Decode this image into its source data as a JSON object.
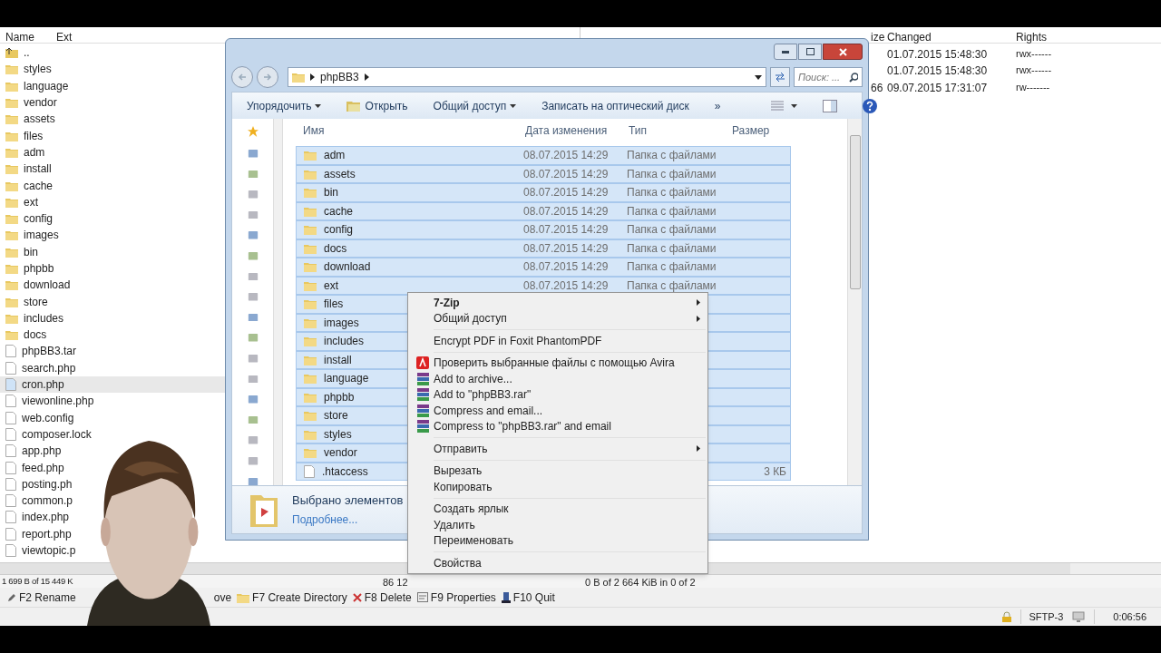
{
  "file_manager": {
    "left_columns": [
      "Name",
      "Ext"
    ],
    "right_columns": [
      "ize",
      "Changed",
      "Rights"
    ],
    "left_rows": [
      {
        "name": "..",
        "kind": "parent",
        "selected": false
      },
      {
        "name": "styles",
        "kind": "folder",
        "selected": false
      },
      {
        "name": "language",
        "kind": "folder",
        "selected": false
      },
      {
        "name": "vendor",
        "kind": "folder",
        "selected": false
      },
      {
        "name": "assets",
        "kind": "folder",
        "selected": false
      },
      {
        "name": "files",
        "kind": "folder",
        "selected": false
      },
      {
        "name": "adm",
        "kind": "folder",
        "selected": false
      },
      {
        "name": "install",
        "kind": "folder",
        "selected": false
      },
      {
        "name": "cache",
        "kind": "folder",
        "selected": false
      },
      {
        "name": "ext",
        "kind": "folder",
        "selected": false
      },
      {
        "name": "config",
        "kind": "folder",
        "selected": false
      },
      {
        "name": "images",
        "kind": "folder",
        "selected": false
      },
      {
        "name": "bin",
        "kind": "folder",
        "selected": false
      },
      {
        "name": "phpbb",
        "kind": "folder",
        "selected": false
      },
      {
        "name": "download",
        "kind": "folder",
        "selected": false
      },
      {
        "name": "store",
        "kind": "folder",
        "selected": false
      },
      {
        "name": "includes",
        "kind": "folder",
        "selected": false
      },
      {
        "name": "docs",
        "kind": "folder",
        "selected": false
      },
      {
        "name": "phpBB3.tar",
        "kind": "file",
        "selected": false
      },
      {
        "name": "search.php",
        "kind": "file",
        "selected": false
      },
      {
        "name": "cron.php",
        "kind": "file",
        "selected": true
      },
      {
        "name": "viewonline.php",
        "kind": "file",
        "selected": false
      },
      {
        "name": "web.config",
        "kind": "file",
        "selected": false
      },
      {
        "name": "composer.lock",
        "kind": "file",
        "selected": false
      },
      {
        "name": "app.php",
        "kind": "file",
        "selected": false
      },
      {
        "name": "feed.php",
        "kind": "file",
        "selected": false
      },
      {
        "name": "posting.ph",
        "kind": "file",
        "selected": false
      },
      {
        "name": "common.p",
        "kind": "file",
        "selected": false
      },
      {
        "name": "index.php",
        "kind": "file",
        "selected": false
      },
      {
        "name": "report.php",
        "kind": "file",
        "selected": false
      },
      {
        "name": "viewtopic.p",
        "kind": "file",
        "selected": false
      }
    ],
    "right_rows": [
      {
        "size": "",
        "changed": "01.07.2015 15:48:30",
        "rights": "rwx------"
      },
      {
        "size": "",
        "changed": "01.07.2015 15:48:30",
        "rights": "rwx------"
      },
      {
        "size": "66",
        "changed": "09.07.2015 17:31:07",
        "rights": "rw-------"
      }
    ],
    "left_status": "1 699 B of 15 449 K",
    "middle_status": "86 12",
    "right_status": "0 B of 2 664 KiB in 0 of 2",
    "function_keys": [
      {
        "label": "F2 Rename",
        "kind": "pencil"
      },
      {
        "label": "ove",
        "kind": "none"
      },
      {
        "label": "F7 Create Directory",
        "kind": "folder"
      },
      {
        "label": "F8 Delete",
        "kind": "cross"
      },
      {
        "label": "F9 Properties",
        "kind": "props"
      },
      {
        "label": "F10 Quit",
        "kind": "quit"
      }
    ],
    "protocol": "SFTP-3",
    "elapsed": "0:06:56"
  },
  "explorer": {
    "path": "phpBB3",
    "search_placeholder": "Поиск: ...",
    "toolbar": [
      {
        "label": "Упорядочить",
        "kind": "dropdown"
      },
      {
        "label": "Открыть",
        "kind": "open"
      },
      {
        "label": "Общий доступ",
        "kind": "dropdown"
      },
      {
        "label": "Записать на оптический диск",
        "kind": "plain"
      },
      {
        "label": "»",
        "kind": "plain"
      }
    ],
    "columns": [
      "Имя",
      "Дата изменения",
      "Тип",
      "Размер"
    ],
    "rows": [
      {
        "name": "adm",
        "kind": "folder",
        "date": "08.07.2015 14:29",
        "type": "Папка с файлами",
        "size": "",
        "selected": true
      },
      {
        "name": "assets",
        "kind": "folder",
        "date": "08.07.2015 14:29",
        "type": "Папка с файлами",
        "size": "",
        "selected": true
      },
      {
        "name": "bin",
        "kind": "folder",
        "date": "08.07.2015 14:29",
        "type": "Папка с файлами",
        "size": "",
        "selected": true
      },
      {
        "name": "cache",
        "kind": "folder",
        "date": "08.07.2015 14:29",
        "type": "Папка с файлами",
        "size": "",
        "selected": true
      },
      {
        "name": "config",
        "kind": "folder",
        "date": "08.07.2015 14:29",
        "type": "Папка с файлами",
        "size": "",
        "selected": true
      },
      {
        "name": "docs",
        "kind": "folder",
        "date": "08.07.2015 14:29",
        "type": "Папка с файлами",
        "size": "",
        "selected": true
      },
      {
        "name": "download",
        "kind": "folder",
        "date": "08.07.2015 14:29",
        "type": "Папка с файлами",
        "size": "",
        "selected": true
      },
      {
        "name": "ext",
        "kind": "folder",
        "date": "08.07.2015 14:29",
        "type": "Папка с файлами",
        "size": "",
        "selected": true
      },
      {
        "name": "files",
        "kind": "folder",
        "date": "",
        "type": "",
        "size": "",
        "selected": true
      },
      {
        "name": "images",
        "kind": "folder",
        "date": "",
        "type": "",
        "size": "",
        "selected": true
      },
      {
        "name": "includes",
        "kind": "folder",
        "date": "",
        "type": "",
        "size": "",
        "selected": true
      },
      {
        "name": "install",
        "kind": "folder",
        "date": "",
        "type": "",
        "size": "",
        "selected": true
      },
      {
        "name": "language",
        "kind": "folder",
        "date": "",
        "type": "",
        "size": "",
        "selected": true
      },
      {
        "name": "phpbb",
        "kind": "folder",
        "date": "",
        "type": "",
        "size": "",
        "selected": true
      },
      {
        "name": "store",
        "kind": "folder",
        "date": "",
        "type": "",
        "size": "",
        "selected": true
      },
      {
        "name": "styles",
        "kind": "folder",
        "date": "",
        "type": "",
        "size": "",
        "selected": true
      },
      {
        "name": "vendor",
        "kind": "folder",
        "date": "",
        "type": "",
        "size": "",
        "selected": true
      },
      {
        "name": ".htaccess",
        "kind": "file",
        "date": "",
        "type": "",
        "size": "3 КБ",
        "selected": true
      }
    ],
    "details_title": "Выбрано элементов",
    "details_link": "Подробнее..."
  },
  "context_menu": [
    {
      "kind": "submenu",
      "label": "7-Zip",
      "bold": true
    },
    {
      "kind": "submenu",
      "label": "Общий доступ",
      "bold": false
    },
    {
      "kind": "separator"
    },
    {
      "kind": "item",
      "label": "Encrypt PDF in Foxit PhantomPDF",
      "bold": false
    },
    {
      "kind": "separator"
    },
    {
      "kind": "antivirus",
      "label": "Проверить выбранные файлы с помощью Avira",
      "bold": false
    },
    {
      "kind": "archive",
      "label": "Add to archive...",
      "bold": false
    },
    {
      "kind": "archive",
      "label": "Add to \"phpBB3.rar\"",
      "bold": false
    },
    {
      "kind": "archive",
      "label": "Compress and email...",
      "bold": false
    },
    {
      "kind": "archive",
      "label": "Compress to \"phpBB3.rar\" and email",
      "bold": false
    },
    {
      "kind": "separator"
    },
    {
      "kind": "submenu",
      "label": "Отправить",
      "bold": false
    },
    {
      "kind": "separator"
    },
    {
      "kind": "item",
      "label": "Вырезать",
      "bold": false
    },
    {
      "kind": "item",
      "label": "Копировать",
      "bold": false
    },
    {
      "kind": "separator"
    },
    {
      "kind": "item",
      "label": "Создать ярлык",
      "bold": false
    },
    {
      "kind": "item",
      "label": "Удалить",
      "bold": false
    },
    {
      "kind": "item",
      "label": "Переименовать",
      "bold": false
    },
    {
      "kind": "separator"
    },
    {
      "kind": "item",
      "label": "Свойства",
      "bold": false
    }
  ]
}
